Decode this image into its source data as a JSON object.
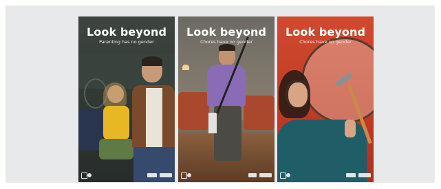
{
  "posters": [
    {
      "title": "Look beyond",
      "subtitle": "Parenting has no gender"
    },
    {
      "title": "Look beyond",
      "subtitle": "Chores have no gender"
    },
    {
      "title": "Look beyond",
      "subtitle": "Chores have no gender"
    }
  ],
  "colors": {
    "frame_background": "#e8e9ea",
    "poster1_background": "#323a35",
    "poster2_background": "#8e8170",
    "poster3_background": "#c23b24",
    "title_text": "#ffffff"
  },
  "icons": [
    "partner-logo",
    "un-women-logo",
    "sponsor-logo"
  ]
}
